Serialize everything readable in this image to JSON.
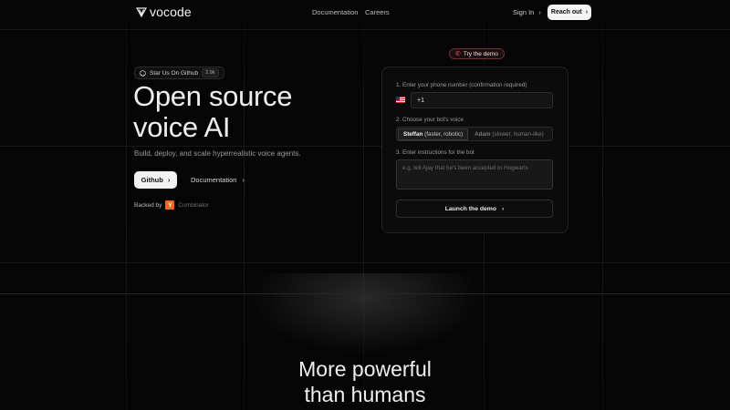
{
  "nav": {
    "brand": "vocode",
    "links": [
      "Documentation",
      "Careers"
    ],
    "sign_in": "Sign In",
    "reach_out": "Reach out"
  },
  "hero": {
    "star_label": "Star Us On Github",
    "star_count": "2.9k",
    "title_line1": "Open source",
    "title_line2": "voice AI",
    "subtitle": "Build, deploy, and scale hyperrealistic voice agents.",
    "github_button": "Github",
    "docs_button": "Documentation",
    "backed_by": "Backed by",
    "yc_letter": "Y",
    "yc_name": "Combinator"
  },
  "demo": {
    "try_label": "Try the demo",
    "phone_label": "1. Enter your phone number (confirmation required)",
    "phone_value": "+1",
    "voice_label": "2. Choose your bot's voice",
    "voices": [
      {
        "name": "Steffan",
        "desc": "(faster, robotic)",
        "active": true
      },
      {
        "name": "Adam",
        "desc": "(slower, human-like)",
        "active": false
      }
    ],
    "instructions_label": "3. Enter instructions for the bot",
    "instructions_placeholder": "e.g. tell Ajay that he's been accepted to Hogwarts",
    "launch_button": "Launch the demo"
  },
  "section2": {
    "line1": "More powerful",
    "line2": "than humans"
  },
  "colors": {
    "background": "#050505",
    "yc_orange": "#f26522",
    "try_border": "#6b3030"
  }
}
